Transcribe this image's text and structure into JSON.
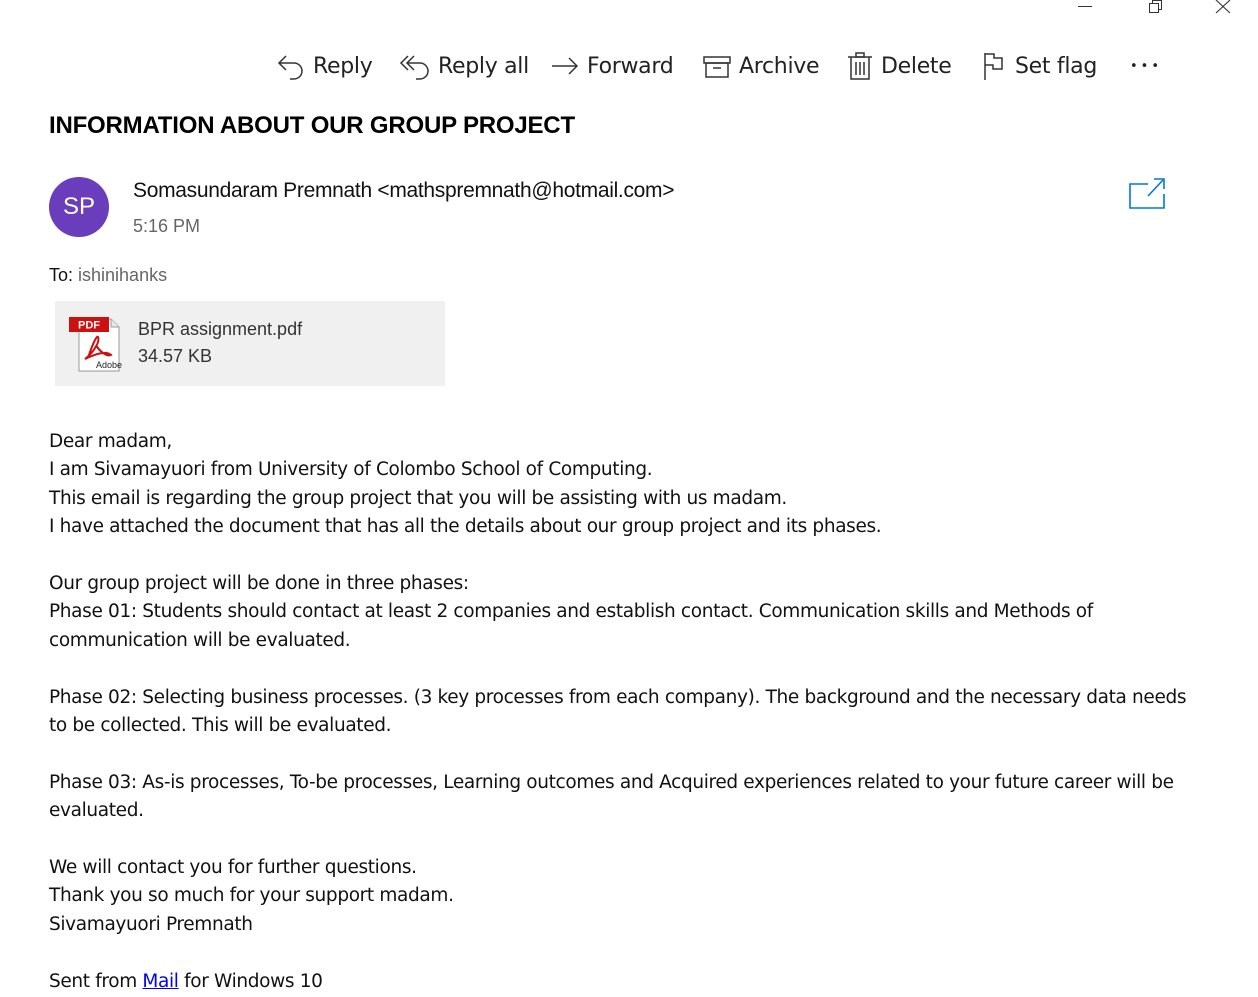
{
  "window": {
    "controls": [
      "minimize-icon",
      "restore-icon",
      "close-icon"
    ]
  },
  "toolbar": {
    "reply": "Reply",
    "reply_all": "Reply all",
    "forward": "Forward",
    "archive": "Archive",
    "delete": "Delete",
    "set_flag": "Set flag",
    "more": "•••"
  },
  "message": {
    "subject": "INFORMATION ABOUT OUR GROUP PROJECT",
    "avatar_initials": "SP",
    "sender": "Somasundaram Premnath <mathspremnath@hotmail.com>",
    "time": "5:16 PM",
    "to_label": "To:",
    "to": "ishinihanks",
    "attachment": {
      "name": "BPR assignment.pdf",
      "size": "34.57 KB",
      "icon_badge": "PDF",
      "icon_brand": "Adobe"
    },
    "body": {
      "p1": "Dear madam,",
      "p2": "I am Sivamayuori from University of Colombo School of Computing.",
      "p3": "This email is regarding the group project that you will be assisting with us madam.",
      "p4": "I have attached the document that has all the details about our group project and its phases.",
      "p5": "Our group project will be done in three phases:",
      "p6": "Phase 01: Students should contact at least 2 companies and establish contact. Communication skills and Methods of communication will be evaluated.",
      "p7": "Phase 02: Selecting business processes. (3 key processes from each company). The background and the necessary data needs to be collected. This will be evaluated.",
      "p8": "Phase 03: As-is processes, To-be processes, Learning outcomes and Acquired experiences related to your future career will be evaluated.",
      "p9": "We will contact you for further questions.",
      "p10": "Thank you so much for your support madam.",
      "p11": "Sivamayuori Premnath",
      "signature_prefix": "Sent from ",
      "signature_link": "Mail",
      "signature_suffix": " for Windows 10"
    }
  },
  "colors": {
    "avatar_bg": "#6a3dbd",
    "accent": "#0078d7",
    "link": "#0000ee"
  }
}
